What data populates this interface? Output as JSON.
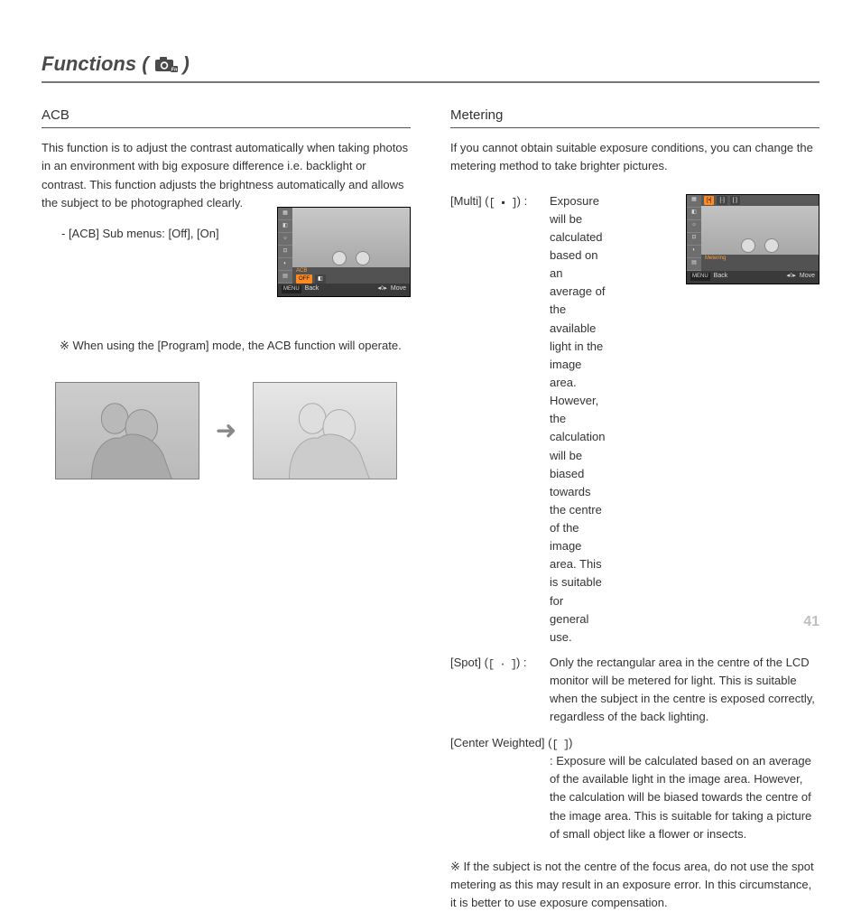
{
  "page_title_prefix": "Functions (",
  "page_title_suffix": ")",
  "page_number": "41",
  "left": {
    "heading": "ACB",
    "body": "This function is to adjust the contrast automatically when taking photos in an environment with big exposure difference i.e. backlight or contrast. This function adjusts the brightness automatically and allows the subject to be photographed clearly.",
    "submenu_line": "- [ACB] Sub menus: [Off], [On]",
    "note": "※ When using the [Program] mode, the ACB function will operate.",
    "screen": {
      "label": "ACB",
      "chip_off": "OFF",
      "chip_on_icon": "◧",
      "back": "Back",
      "move": "Move",
      "menu": "MENU"
    }
  },
  "right": {
    "heading": "Metering",
    "body": "If you cannot obtain suitable exposure conditions, you can change the metering method to take brighter pictures.",
    "screen": {
      "label": "Metering",
      "back": "Back",
      "move": "Move",
      "menu": "MENU",
      "chip1": "[▪]",
      "chip2": "[·]",
      "chip3": "[ ]"
    },
    "items": [
      {
        "label": "[Multi] (",
        "icon": "[ ▪ ]",
        "label_close": ") :",
        "text": "Exposure will be calculated based on an average of the available light in the image area. However, the calculation will be biased towards the centre of the image area. This is suitable for general use."
      },
      {
        "label": "[Spot] (",
        "icon": "[ · ]",
        "label_close": ") :",
        "text": "Only the rectangular area in the centre of the LCD monitor will be metered for light. This is suitable when the subject in the centre is exposed correctly, regardless of the back lighting."
      },
      {
        "label": "[Center Weighted] (",
        "icon": "[   ]",
        "label_close": ")",
        "text": ": Exposure will be calculated based on an average of the available light in the image area. However, the calculation will be biased towards the centre of the image area. This is suitable for taking a picture of small object like a flower or insects."
      }
    ],
    "footnote": "※ If the subject is not the centre of the focus area, do not use the spot metering as this may result in an exposure error. In this circumstance, it is better to use exposure compensation."
  }
}
